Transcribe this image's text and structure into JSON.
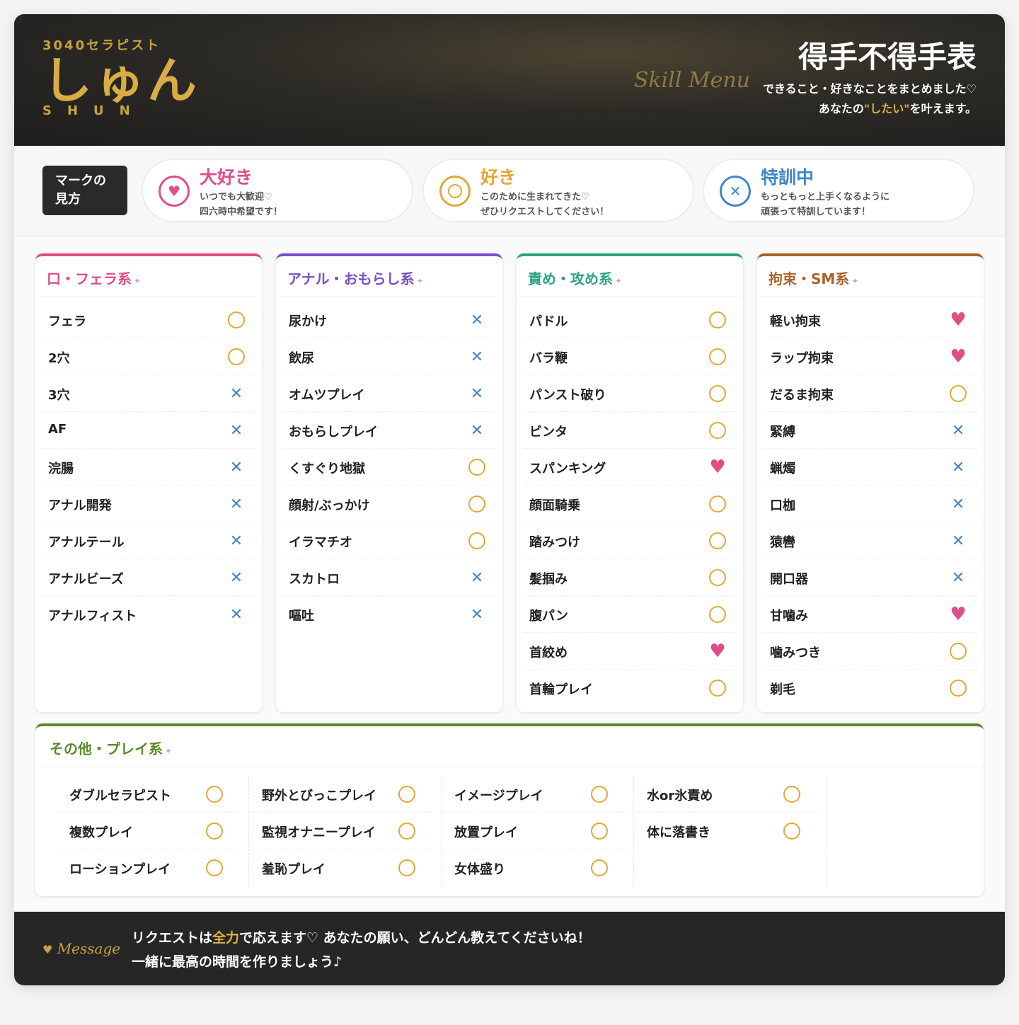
{
  "header": {
    "brand_sub": "3040セラピスト",
    "brand_name": "しゅん",
    "brand_roman": "SHUN",
    "title": "得手不得手表",
    "skill_menu": "Skill Menu",
    "desc_line1": "できること・好きなことをまとめました♡",
    "desc_line2_pre": "あなたの",
    "desc_line2_em": "\"したい\"",
    "desc_line2_post": "を叶えます。"
  },
  "legend": {
    "label_line1": "マークの",
    "label_line2": "見方",
    "items": [
      {
        "title": "大好き",
        "line1": "いつでも大歓迎♡",
        "line2": "四六時中希望です！",
        "color": "#e04e86",
        "icon": "heart-icon"
      },
      {
        "title": "好き",
        "line1": "このために生まれてきた♡",
        "line2": "ぜひリクエストしてください！",
        "color": "#e2a835",
        "icon": "circle-icon"
      },
      {
        "title": "特訓中",
        "line1": "もっともっと上手くなるように",
        "line2": "頑張って特訓しています！",
        "color": "#3f86c8",
        "icon": "cross-icon"
      }
    ]
  },
  "colors": {
    "heart": "#e04e86",
    "circle": "#e2a835",
    "cross": "#3f86c8",
    "cat_oral": "#e04e86",
    "cat_anal": "#7b4fc9",
    "cat_attack": "#2aa584",
    "cat_bondage": "#a8632a",
    "cat_other": "#5c8a2a"
  },
  "categories": [
    {
      "title": "口・フェラ系",
      "items": [
        {
          "label": "フェラ",
          "mark": "circle"
        },
        {
          "label": "2穴",
          "mark": "circle"
        },
        {
          "label": "3穴",
          "mark": "cross"
        },
        {
          "label": "AF",
          "mark": "cross"
        },
        {
          "label": "浣腸",
          "mark": "cross"
        },
        {
          "label": "アナル開発",
          "mark": "cross"
        },
        {
          "label": "アナルテール",
          "mark": "cross"
        },
        {
          "label": "アナルビーズ",
          "mark": "cross"
        },
        {
          "label": "アナルフィスト",
          "mark": "cross"
        }
      ]
    },
    {
      "title": "アナル・おもらし系",
      "items": [
        {
          "label": "尿かけ",
          "mark": "cross"
        },
        {
          "label": "飲尿",
          "mark": "cross"
        },
        {
          "label": "オムツプレイ",
          "mark": "cross"
        },
        {
          "label": "おもらしプレイ",
          "mark": "cross"
        },
        {
          "label": "くすぐり地獄",
          "mark": "circle"
        },
        {
          "label": "顔射/ぶっかけ",
          "mark": "circle"
        },
        {
          "label": "イラマチオ",
          "mark": "circle"
        },
        {
          "label": "スカトロ",
          "mark": "cross"
        },
        {
          "label": "嘔吐",
          "mark": "cross"
        }
      ]
    },
    {
      "title": "責め・攻め系",
      "items": [
        {
          "label": "パドル",
          "mark": "circle"
        },
        {
          "label": "バラ鞭",
          "mark": "circle"
        },
        {
          "label": "パンスト破り",
          "mark": "circle"
        },
        {
          "label": "ビンタ",
          "mark": "circle"
        },
        {
          "label": "スパンキング",
          "mark": "heart"
        },
        {
          "label": "顔面騎乗",
          "mark": "circle"
        },
        {
          "label": "踏みつけ",
          "mark": "circle"
        },
        {
          "label": "髪掴み",
          "mark": "circle"
        },
        {
          "label": "腹パン",
          "mark": "circle"
        },
        {
          "label": "首絞め",
          "mark": "heart"
        },
        {
          "label": "首輪プレイ",
          "mark": "circle"
        }
      ]
    },
    {
      "title": "拘束・SM系",
      "items": [
        {
          "label": "軽い拘束",
          "mark": "heart"
        },
        {
          "label": "ラップ拘束",
          "mark": "heart"
        },
        {
          "label": "だるま拘束",
          "mark": "circle"
        },
        {
          "label": "緊縛",
          "mark": "cross"
        },
        {
          "label": "蝋燭",
          "mark": "cross"
        },
        {
          "label": "口枷",
          "mark": "cross"
        },
        {
          "label": "猿轡",
          "mark": "cross"
        },
        {
          "label": "開口器",
          "mark": "cross"
        },
        {
          "label": "甘噛み",
          "mark": "heart"
        },
        {
          "label": "噛みつき",
          "mark": "circle"
        },
        {
          "label": "剃毛",
          "mark": "circle"
        }
      ]
    }
  ],
  "other": {
    "title": "その他・プレイ系",
    "columns": [
      [
        {
          "label": "ダブルセラピスト",
          "mark": "circle"
        },
        {
          "label": "複数プレイ",
          "mark": "circle"
        },
        {
          "label": "ローションプレイ",
          "mark": "circle"
        }
      ],
      [
        {
          "label": "野外とびっこプレイ",
          "mark": "circle"
        },
        {
          "label": "監視オナニープレイ",
          "mark": "circle"
        },
        {
          "label": "羞恥プレイ",
          "mark": "circle"
        }
      ],
      [
        {
          "label": "イメージプレイ",
          "mark": "circle"
        },
        {
          "label": "放置プレイ",
          "mark": "circle"
        },
        {
          "label": "女体盛り",
          "mark": "circle"
        }
      ],
      [
        {
          "label": "水or氷責め",
          "mark": "circle"
        },
        {
          "label": "体に落書き",
          "mark": "circle"
        }
      ]
    ]
  },
  "footer": {
    "label": "Message",
    "line1_pre": "リクエストは",
    "line1_em": "全力",
    "line1_post": "で応えます♡ あなたの願い、どんどん教えてくださいね！",
    "line2": "一緒に最高の時間を作りましょう♪"
  }
}
